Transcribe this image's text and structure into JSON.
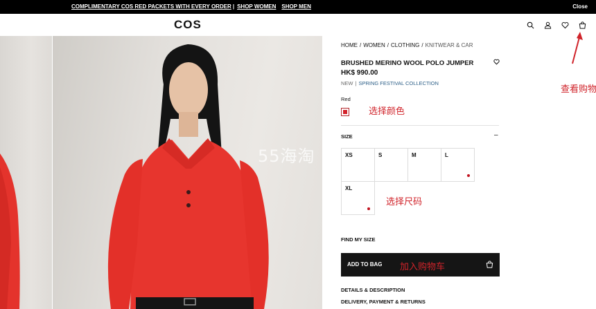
{
  "promo": {
    "text1": "COMPLIMENTARY COS RED PACKETS WITH EVERY ORDER",
    "sep": "|",
    "link1": "SHOP WOMEN",
    "link2": "SHOP MEN",
    "close": "Close"
  },
  "header": {
    "logo": "COS",
    "icons": [
      "search-icon",
      "account-icon",
      "wishlist-icon",
      "bag-icon"
    ]
  },
  "breadcrumb": [
    "HOME",
    "WOMEN",
    "CLOTHING",
    "KNITWEAR & CAR"
  ],
  "product": {
    "title": "BRUSHED MERINO WOOL POLO JUMPER",
    "price": "HK$ 990.00",
    "tag_new": "NEW",
    "tag_sep": "|",
    "collection": "SPRING FESTIVAL COLLECTION",
    "color_label": "Red",
    "swatch_color": "#d3222a"
  },
  "size": {
    "label": "SIZE",
    "toggle": "–",
    "options": [
      {
        "label": "XS",
        "low_stock": false
      },
      {
        "label": "S",
        "low_stock": false
      },
      {
        "label": "M",
        "low_stock": false
      },
      {
        "label": "L",
        "low_stock": true
      },
      {
        "label": "XL",
        "low_stock": true
      }
    ]
  },
  "find_my_size": "FIND MY SIZE",
  "add_to_bag": "ADD TO BAG",
  "sections": {
    "details": "DETAILS & DESCRIPTION",
    "delivery": "DELIVERY, PAYMENT & RETURNS"
  },
  "annotations": {
    "choose_color": "选择颜色",
    "choose_size": "选择尺码",
    "add_to_cart": "加入购物车",
    "view_cart": "查看购物车",
    "watermark": "55海淘"
  },
  "colors": {
    "accent_red": "#d0232a",
    "button_dark": "#151515",
    "collection_blue": "#2a5d86"
  }
}
